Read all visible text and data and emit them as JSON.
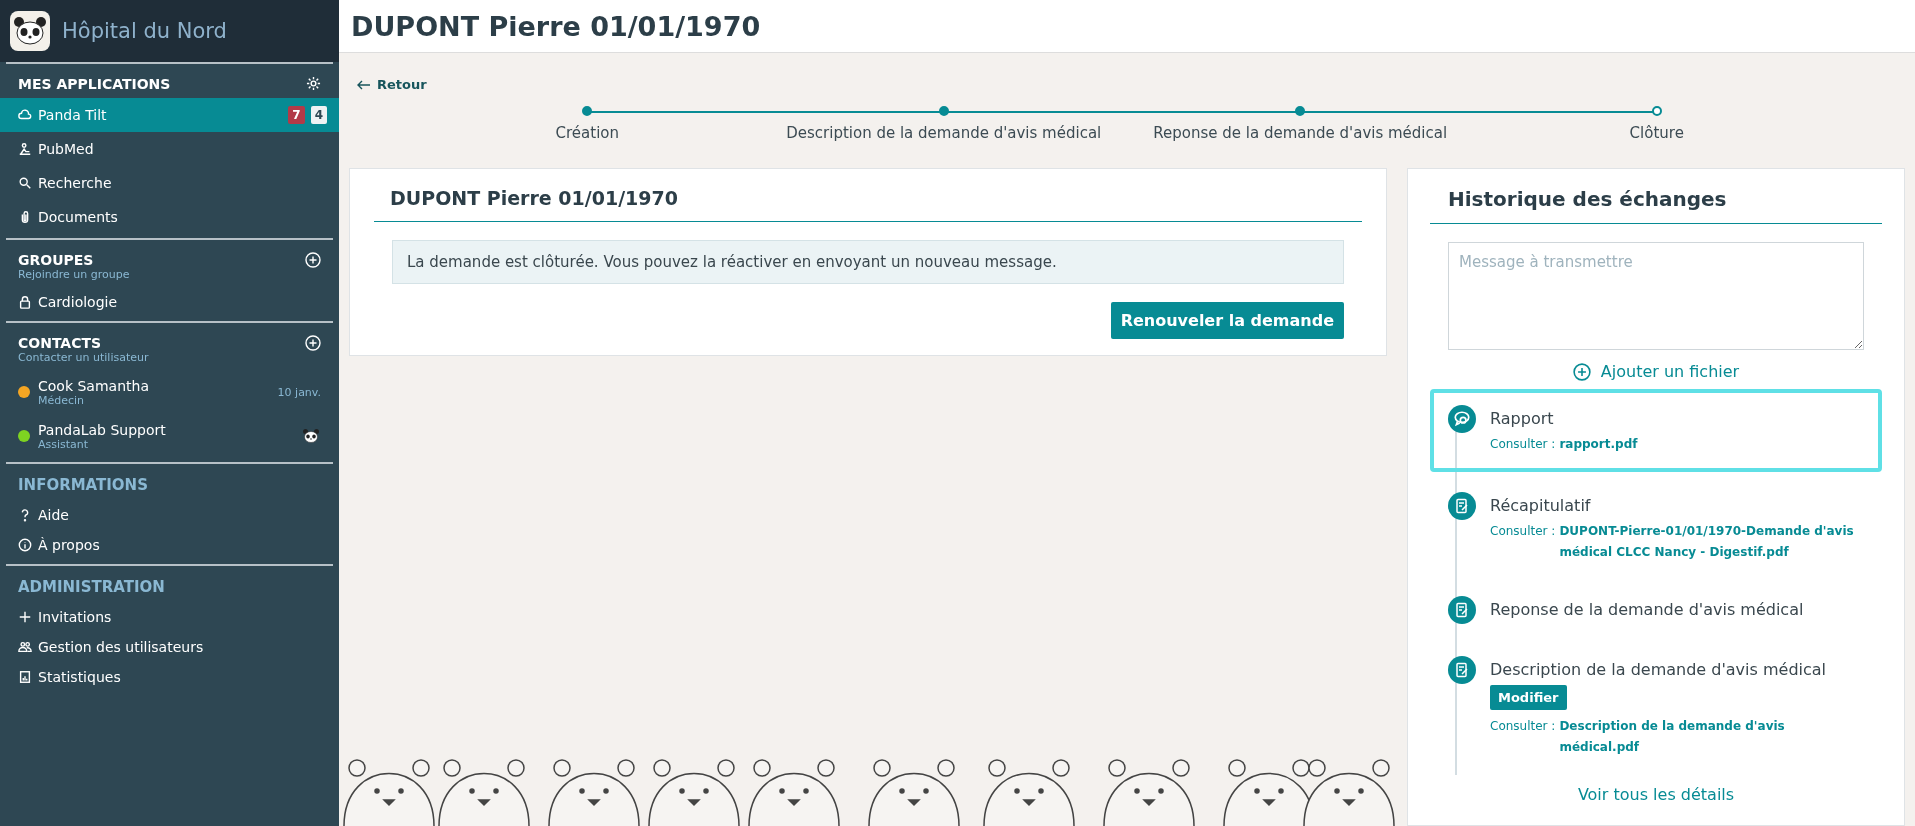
{
  "brand": {
    "name": "Hôpital du Nord"
  },
  "sidebar": {
    "sections": [
      {
        "title": "MES APPLICATIONS",
        "kind": "apps",
        "items": [
          {
            "label": "Panda Tilt",
            "selected": true,
            "badges": [
              {
                "text": "7",
                "color": "#b23a48"
              },
              {
                "text": "4",
                "color": "#eef2f4"
              }
            ]
          },
          {
            "label": "PubMed",
            "selected": false
          },
          {
            "label": "Recherche",
            "selected": false
          },
          {
            "label": "Documents",
            "selected": false
          }
        ]
      },
      {
        "title": "GROUPES",
        "subtitle": "Rejoindre un groupe",
        "kind": "groups",
        "items": [
          {
            "label": "Cardiologie",
            "selected": false
          }
        ]
      },
      {
        "title": "CONTACTS",
        "subtitle": "Contacter un utilisateur",
        "kind": "contacts",
        "contacts": [
          {
            "name": "Cook Samantha",
            "role": "Médecin",
            "color": "#f5a623",
            "date": "10 janv."
          },
          {
            "name": "PandaLab Support",
            "role": "Assistant",
            "color": "#7ed321"
          }
        ]
      },
      {
        "title": "INFORMATIONS",
        "kind": "info",
        "items": [
          {
            "label": "Aide",
            "selected": false
          },
          {
            "label": "À propos",
            "selected": false
          }
        ]
      },
      {
        "title": "ADMINISTRATION",
        "kind": "admin",
        "items": [
          {
            "label": "Invitations",
            "selected": false
          },
          {
            "label": "Gestion des utilisateurs",
            "selected": false
          },
          {
            "label": "Statistiques",
            "selected": false
          }
        ]
      }
    ]
  },
  "page_title": "DUPONT Pierre 01/01/1970",
  "back_link": "Retour",
  "steps": [
    {
      "label": "Création",
      "completed": true
    },
    {
      "label": "Description de la demande d'avis médical",
      "completed": true
    },
    {
      "label": "Reponse de la demande d'avis médical",
      "completed": true
    },
    {
      "label": "Clôture",
      "completed": false
    }
  ],
  "request_card": {
    "title": "DUPONT Pierre 01/01/1970",
    "alert": "La demande est clôturée. Vous pouvez la réactiver en envoyant un nouveau message.",
    "button": "Renouveler la demande"
  },
  "history": {
    "title": "Historique des échanges",
    "message_placeholder": "Message à transmettre",
    "add_file": "Ajouter un fichier",
    "entries": [
      {
        "kind": "chat",
        "title": "Rapport",
        "selected": true,
        "consult_label": "Consulter :",
        "file": "rapport.pdf"
      },
      {
        "kind": "document",
        "title": "Récapitulatif",
        "selected": false,
        "consult_label": "Consulter :",
        "file": "DUPONT-Pierre-01/01/1970-Demande d'avis médical CLCC Nancy - Digestif.pdf"
      },
      {
        "kind": "document",
        "title": "Reponse de la demande d'avis médical",
        "selected": false
      },
      {
        "kind": "document",
        "title": "Description de la demande d'avis médical",
        "selected": false,
        "button": "Modifier",
        "consult_label": "Consulter :",
        "file": "Description de la demande d'avis médical.pdf"
      }
    ],
    "details_link": "Voir tous les détails"
  }
}
